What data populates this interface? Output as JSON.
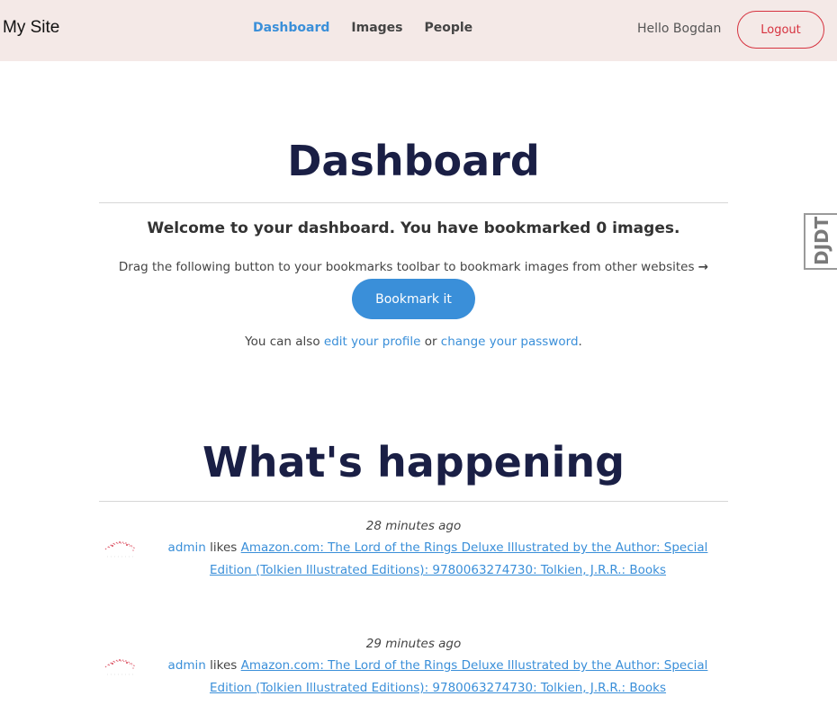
{
  "header": {
    "brand": "My Site",
    "nav": [
      {
        "label": "Dashboard",
        "active": true
      },
      {
        "label": "Images",
        "active": false
      },
      {
        "label": "People",
        "active": false
      }
    ],
    "greeting": "Hello Bogdan",
    "logout_label": "Logout"
  },
  "dashboard": {
    "title": "Dashboard",
    "welcome": "Welcome to your dashboard. You have bookmarked 0 images.",
    "drag_text": "Drag the following button to your bookmarks toolbar to bookmark images from other websites",
    "arrow": "→",
    "bookmark_label": "Bookmark it",
    "also_prefix": "You can also",
    "edit_profile_link": "edit your profile",
    "or_text": "or",
    "change_password_link": "change your password",
    "period": "."
  },
  "activity": {
    "title": "What's happening",
    "items": [
      {
        "time": "28 minutes ago",
        "user": "admin",
        "verb": "likes",
        "target": "Amazon.com: The Lord of the Rings Deluxe Illustrated by the Author: Special Edition (Tolkien Illustrated Editions): 9780063274730: Tolkien, J.R.R.: Books"
      },
      {
        "time": "29 minutes ago",
        "user": "admin",
        "verb": "likes",
        "target": "Amazon.com: The Lord of the Rings Deluxe Illustrated by the Author: Special Edition (Tolkien Illustrated Editions): 9780063274730: Tolkien, J.R.R.: Books"
      }
    ]
  },
  "toolbar": {
    "djdt_label": "DJDT"
  },
  "colors": {
    "navbar_bg": "#f4e9e7",
    "accent": "#3a8fd9",
    "logout": "#d6323f",
    "heading": "#1a1f45"
  }
}
